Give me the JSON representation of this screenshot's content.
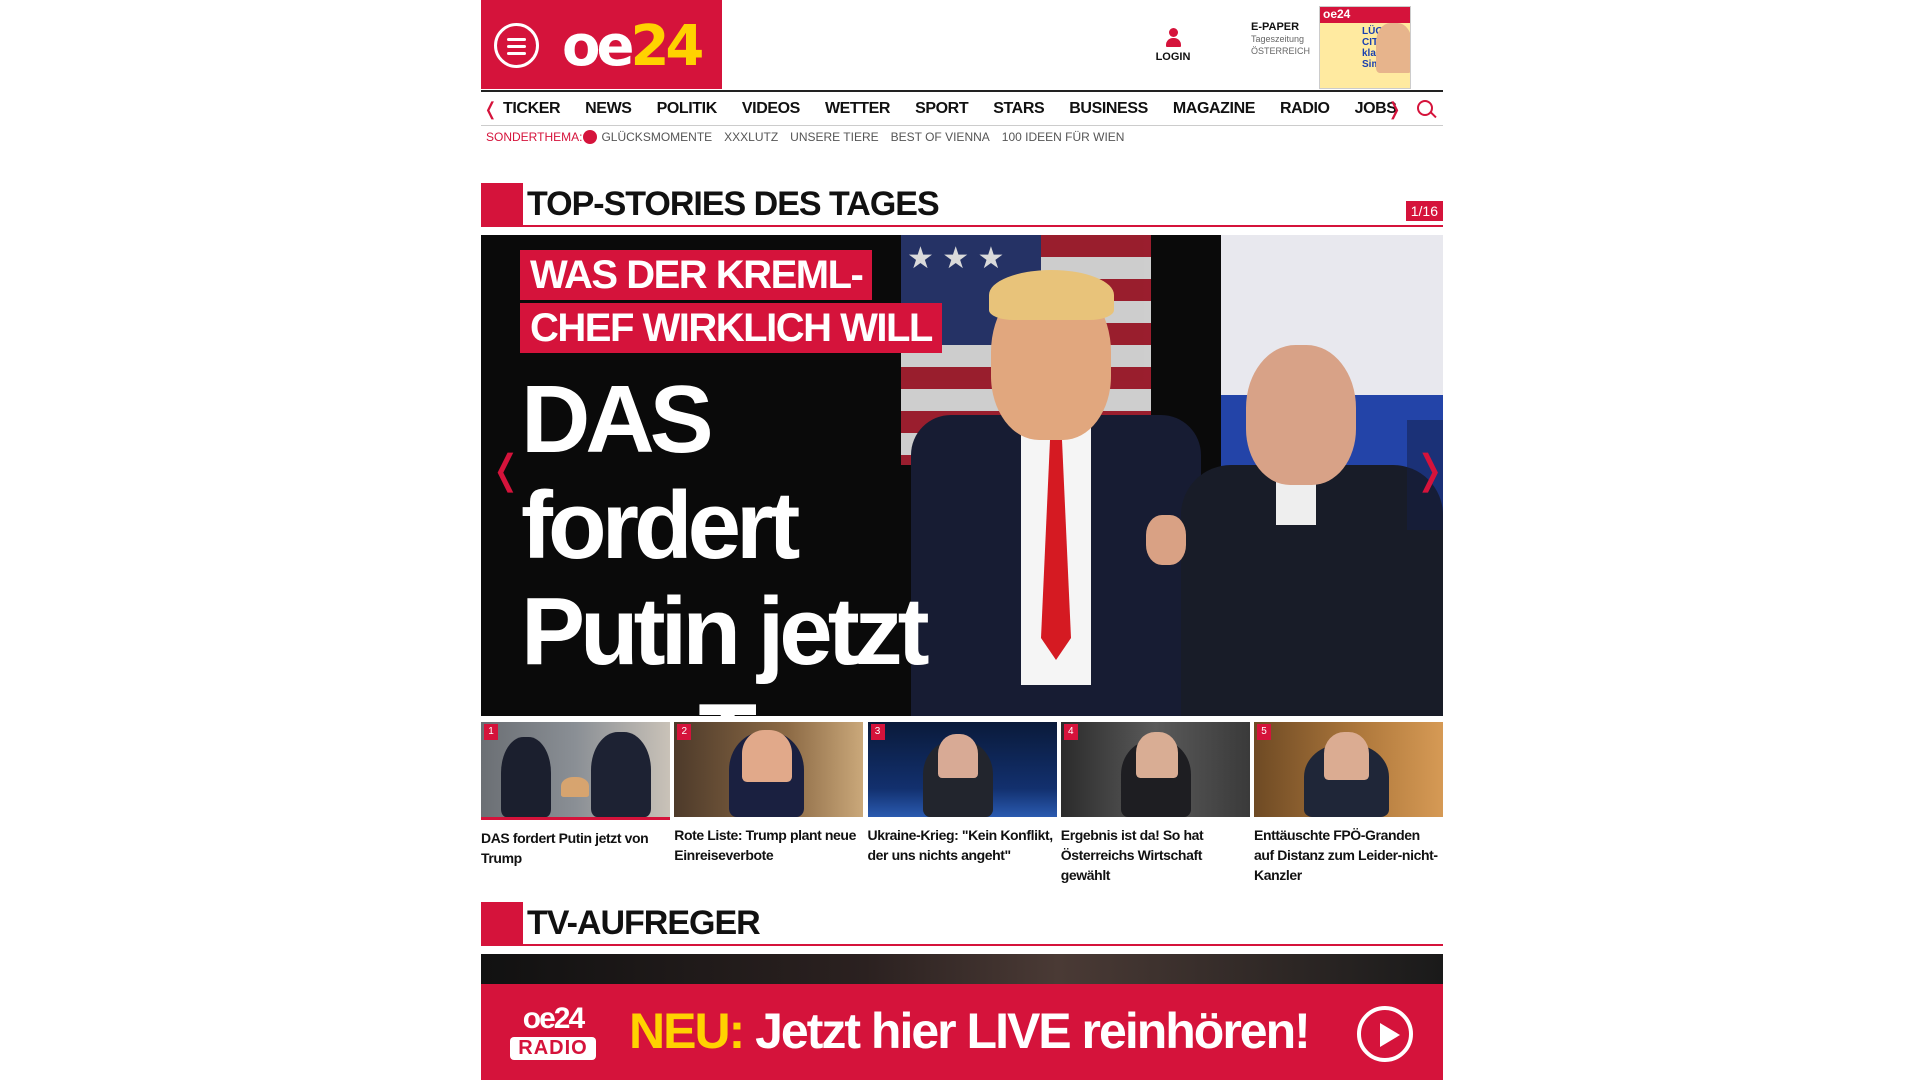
{
  "header": {
    "logo": "oe24",
    "login_label": "LOGIN",
    "epaper": {
      "title": "E-PAPER",
      "line2": "Tageszeitung",
      "line3": "ÖSTERREICH",
      "cover_headline": "LÜGNER CITY klagt Simone"
    }
  },
  "nav": {
    "items": [
      "TICKER",
      "NEWS",
      "POLITIK",
      "VIDEOS",
      "WETTER",
      "SPORT",
      "STARS",
      "BUSINESS",
      "MAGAZINE",
      "RADIO",
      "JOBS"
    ],
    "prev_icon": "chevron-left-icon",
    "next_icon": "chevron-right-icon",
    "search_icon": "search-icon"
  },
  "subnav": {
    "label": "SONDERTHEMA:",
    "items": [
      "GLÜCKSMOMENTE",
      "XXXLUTZ",
      "UNSERE TIERE",
      "BEST OF VIENNA",
      "100 IDEEN FÜR WIEN"
    ]
  },
  "top_stories": {
    "title": "TOP-STORIES DES TAGES",
    "counter": "1/16",
    "hero": {
      "kicker_line1": "WAS DER KREML-",
      "kicker_line2": "CHEF WIRKLICH WILL",
      "headline_line1": "DAS fordert",
      "headline_line2": "Putin jetzt",
      "headline_line3": "von Trump"
    },
    "thumbs": [
      {
        "num": "1",
        "caption": "DAS fordert Putin jetzt von Trump"
      },
      {
        "num": "2",
        "caption": "Rote Liste: Trump plant neue Einreiseverbote"
      },
      {
        "num": "3",
        "caption": "Ukraine-Krieg: \"Kein Konflikt, der uns nichts angeht\""
      },
      {
        "num": "4",
        "caption": "Ergebnis ist da! So hat Österreichs Wirtschaft gewählt"
      },
      {
        "num": "5",
        "caption": "Enttäuschte FPÖ-Granden auf Distanz zum Leider-nicht-Kanzler"
      }
    ]
  },
  "tv": {
    "title": "TV-AUFREGER"
  },
  "radio_banner": {
    "logo_top": "oe24",
    "logo_bottom": "RADIO",
    "neu": "NEU:",
    "text": "Jetzt hier LIVE reinhören!"
  },
  "colors": {
    "brand_red": "#d5133b",
    "brand_yellow": "#ffd200"
  }
}
